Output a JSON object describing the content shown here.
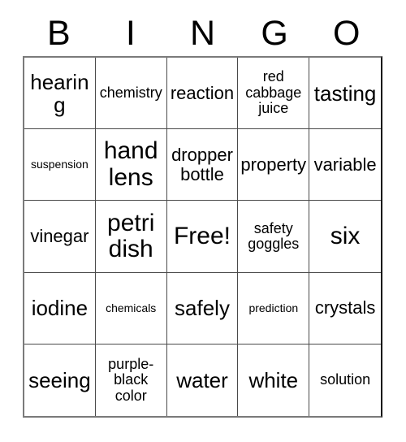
{
  "card": {
    "title": "Bingo Card",
    "header": {
      "letters": [
        "B",
        "I",
        "N",
        "G",
        "O"
      ]
    },
    "columns": 5,
    "rows": 5,
    "free_space_label": "Free!",
    "colors": {
      "background": "#ffffff",
      "text": "#000000",
      "grid_line": "#4a4a4a",
      "outer_border": "#7a7a7a"
    },
    "cells": [
      {
        "text": "hearing",
        "size": "fs-lg",
        "column": "B",
        "row": 1
      },
      {
        "text": "chemistry",
        "size": "fs-sm",
        "column": "I",
        "row": 1
      },
      {
        "text": "reaction",
        "size": "fs-md",
        "column": "N",
        "row": 1
      },
      {
        "text": "red cabbage juice",
        "size": "fs-sm",
        "column": "G",
        "row": 1
      },
      {
        "text": "tasting",
        "size": "fs-lg",
        "column": "O",
        "row": 1
      },
      {
        "text": "suspension",
        "size": "fs-xs",
        "column": "B",
        "row": 2
      },
      {
        "text": "hand lens",
        "size": "fs-xl",
        "column": "I",
        "row": 2
      },
      {
        "text": "dropper bottle",
        "size": "fs-md",
        "column": "N",
        "row": 2
      },
      {
        "text": "property",
        "size": "fs-md",
        "column": "G",
        "row": 2
      },
      {
        "text": "variable",
        "size": "fs-md",
        "column": "O",
        "row": 2
      },
      {
        "text": "vinegar",
        "size": "fs-md",
        "column": "B",
        "row": 3
      },
      {
        "text": "petri dish",
        "size": "fs-xl",
        "column": "I",
        "row": 3
      },
      {
        "text": "Free!",
        "size": "fs-xl",
        "column": "N",
        "row": 3
      },
      {
        "text": "safety goggles",
        "size": "fs-sm",
        "column": "G",
        "row": 3
      },
      {
        "text": "six",
        "size": "fs-xl",
        "column": "O",
        "row": 3
      },
      {
        "text": "iodine",
        "size": "fs-lg",
        "column": "B",
        "row": 4
      },
      {
        "text": "chemicals",
        "size": "fs-xs",
        "column": "I",
        "row": 4
      },
      {
        "text": "safely",
        "size": "fs-lg",
        "column": "N",
        "row": 4
      },
      {
        "text": "prediction",
        "size": "fs-xs",
        "column": "G",
        "row": 4
      },
      {
        "text": "crystals",
        "size": "fs-md",
        "column": "O",
        "row": 4
      },
      {
        "text": "seeing",
        "size": "fs-lg",
        "column": "B",
        "row": 5
      },
      {
        "text": "purple-black color",
        "size": "fs-sm",
        "column": "I",
        "row": 5
      },
      {
        "text": "water",
        "size": "fs-lg",
        "column": "N",
        "row": 5
      },
      {
        "text": "white",
        "size": "fs-lg",
        "column": "G",
        "row": 5
      },
      {
        "text": "solution",
        "size": "fs-sm",
        "column": "O",
        "row": 5
      }
    ]
  }
}
